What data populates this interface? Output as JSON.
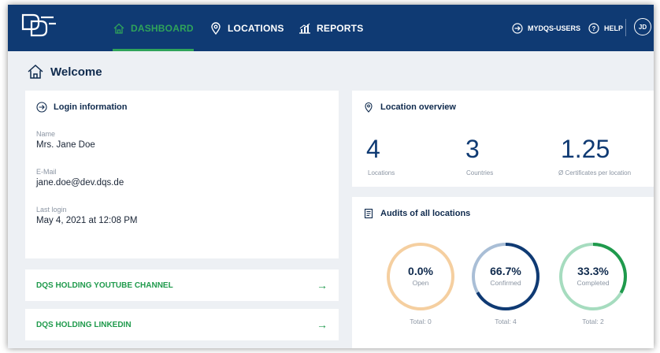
{
  "nav": {
    "items": [
      {
        "label": "DASHBOARD",
        "icon": "home-icon",
        "active": true
      },
      {
        "label": "LOCATIONS",
        "icon": "location-pin-icon",
        "active": false
      },
      {
        "label": "REPORTS",
        "icon": "chart-icon",
        "active": false
      }
    ],
    "mydqs_label": "MYDQS-USERS",
    "help_label": "HELP",
    "avatar_initials": "JD"
  },
  "page": {
    "title": "Welcome"
  },
  "login": {
    "title": "Login information",
    "name_label": "Name",
    "name_value": "Mrs. Jane Doe",
    "email_label": "E-Mail",
    "email_value": "jane.doe@dev.dqs.de",
    "last_login_label": "Last login",
    "last_login_value": "May 4, 2021 at 12:08 PM"
  },
  "links": [
    {
      "label": "DQS HOLDING YOUTUBE CHANNEL",
      "arrow": "→"
    },
    {
      "label": "DQS HOLDING LINKEDIN",
      "arrow": "→"
    }
  ],
  "overview": {
    "title": "Location overview",
    "stats": [
      {
        "value": "4",
        "label": "Locations"
      },
      {
        "value": "3",
        "label": "Countries"
      },
      {
        "value": "1.25",
        "label": "Ø Certificates per location"
      }
    ]
  },
  "audits": {
    "title": "Audits of all locations",
    "rings": [
      {
        "pct_text": "0.0%",
        "fraction": 0.0,
        "label": "Open",
        "total": "Total: 0",
        "color": "#f5cfa0",
        "track": "#f5cfa0"
      },
      {
        "pct_text": "66.7%",
        "fraction": 0.667,
        "label": "Confirmed",
        "total": "Total: 4",
        "color": "#0f3a73",
        "track": "#a9bed6"
      },
      {
        "pct_text": "33.3%",
        "fraction": 0.333,
        "label": "Completed",
        "total": "Total: 2",
        "color": "#1f9a4c",
        "track": "#a6dcbf"
      }
    ]
  },
  "colors": {
    "nav_bg": "#0f3a73",
    "accent_green": "#1f9a4c",
    "page_bg": "#edf0f4"
  }
}
